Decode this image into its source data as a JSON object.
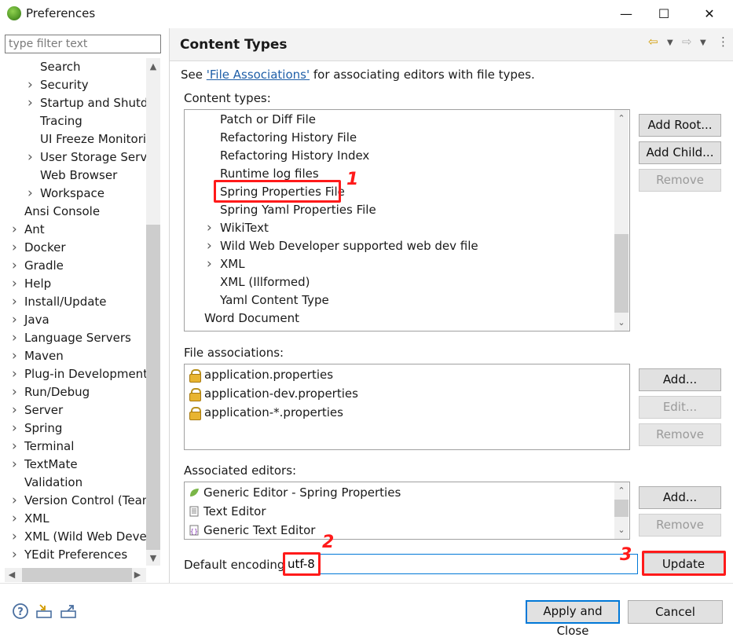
{
  "window": {
    "title": "Preferences",
    "minimize_glyph": "—",
    "maximize_glyph": "☐",
    "close_glyph": "✕"
  },
  "filter": {
    "placeholder": "type filter text"
  },
  "tree": [
    {
      "label": "Search",
      "level": 2,
      "expandable": false
    },
    {
      "label": "Security",
      "level": 2,
      "expandable": true
    },
    {
      "label": "Startup and Shutdown",
      "level": 2,
      "expandable": true
    },
    {
      "label": "Tracing",
      "level": 2,
      "expandable": false
    },
    {
      "label": "UI Freeze Monitoring",
      "level": 2,
      "expandable": false
    },
    {
      "label": "User Storage Service",
      "level": 2,
      "expandable": true
    },
    {
      "label": "Web Browser",
      "level": 2,
      "expandable": false
    },
    {
      "label": "Workspace",
      "level": 2,
      "expandable": true
    },
    {
      "label": "Ansi Console",
      "level": 1,
      "expandable": false
    },
    {
      "label": "Ant",
      "level": 1,
      "expandable": true
    },
    {
      "label": "Docker",
      "level": 1,
      "expandable": true
    },
    {
      "label": "Gradle",
      "level": 1,
      "expandable": true
    },
    {
      "label": "Help",
      "level": 1,
      "expandable": true
    },
    {
      "label": "Install/Update",
      "level": 1,
      "expandable": true
    },
    {
      "label": "Java",
      "level": 1,
      "expandable": true
    },
    {
      "label": "Language Servers",
      "level": 1,
      "expandable": true
    },
    {
      "label": "Maven",
      "level": 1,
      "expandable": true
    },
    {
      "label": "Plug-in Development",
      "level": 1,
      "expandable": true
    },
    {
      "label": "Run/Debug",
      "level": 1,
      "expandable": true
    },
    {
      "label": "Server",
      "level": 1,
      "expandable": true
    },
    {
      "label": "Spring",
      "level": 1,
      "expandable": true
    },
    {
      "label": "Terminal",
      "level": 1,
      "expandable": true
    },
    {
      "label": "TextMate",
      "level": 1,
      "expandable": true
    },
    {
      "label": "Validation",
      "level": 1,
      "expandable": false
    },
    {
      "label": "Version Control (Team)",
      "level": 1,
      "expandable": true
    },
    {
      "label": "XML",
      "level": 1,
      "expandable": true
    },
    {
      "label": "XML (Wild Web Developer)",
      "level": 1,
      "expandable": true
    },
    {
      "label": "YEdit Preferences",
      "level": 1,
      "expandable": true
    }
  ],
  "page": {
    "title": "Content Types",
    "see_prefix": "See ",
    "see_link": "'File Associations'",
    "see_suffix": " for associating editors with file types.",
    "content_types_label": "Content types:",
    "file_assoc_label": "File associations:",
    "assoc_editors_label": "Associated editors:",
    "encoding_label": "Default encoding:",
    "encoding_value": "utf-8"
  },
  "content_types": [
    {
      "label": "Patch or Diff File",
      "indent": 2,
      "expandable": false
    },
    {
      "label": "Refactoring History File",
      "indent": 2,
      "expandable": false
    },
    {
      "label": "Refactoring History Index",
      "indent": 2,
      "expandable": false
    },
    {
      "label": "Runtime log files",
      "indent": 2,
      "expandable": false
    },
    {
      "label": "Spring Properties File",
      "indent": 2,
      "expandable": false,
      "selected": true
    },
    {
      "label": "Spring Yaml Properties File",
      "indent": 2,
      "expandable": false
    },
    {
      "label": "WikiText",
      "indent": 2,
      "expandable": true
    },
    {
      "label": "Wild Web Developer supported web dev file",
      "indent": 2,
      "expandable": true
    },
    {
      "label": "XML",
      "indent": 2,
      "expandable": true
    },
    {
      "label": "XML (Illformed)",
      "indent": 2,
      "expandable": false
    },
    {
      "label": "Yaml Content Type",
      "indent": 2,
      "expandable": false
    },
    {
      "label": "Word Document",
      "indent": 1,
      "expandable": false
    }
  ],
  "file_associations": [
    "application.properties",
    "application-dev.properties",
    "application-*.properties"
  ],
  "editors": [
    {
      "label": "Generic Editor - Spring Properties",
      "icon": "spring-leaf-icon"
    },
    {
      "label": "Text Editor",
      "icon": "text-file-icon"
    },
    {
      "label": "Generic Text Editor",
      "icon": "generic-editor-icon"
    }
  ],
  "buttons": {
    "add_root": "Add Root...",
    "add_child": "Add Child...",
    "remove": "Remove",
    "add": "Add...",
    "edit": "Edit...",
    "update": "Update",
    "apply_close": "Apply and Close",
    "cancel": "Cancel"
  },
  "annotations": {
    "mark1": "1",
    "mark2": "2",
    "mark3": "3"
  },
  "colors": {
    "annotation": "#ff1a1a",
    "link": "#1f5fa8",
    "focus": "#0078d7"
  }
}
